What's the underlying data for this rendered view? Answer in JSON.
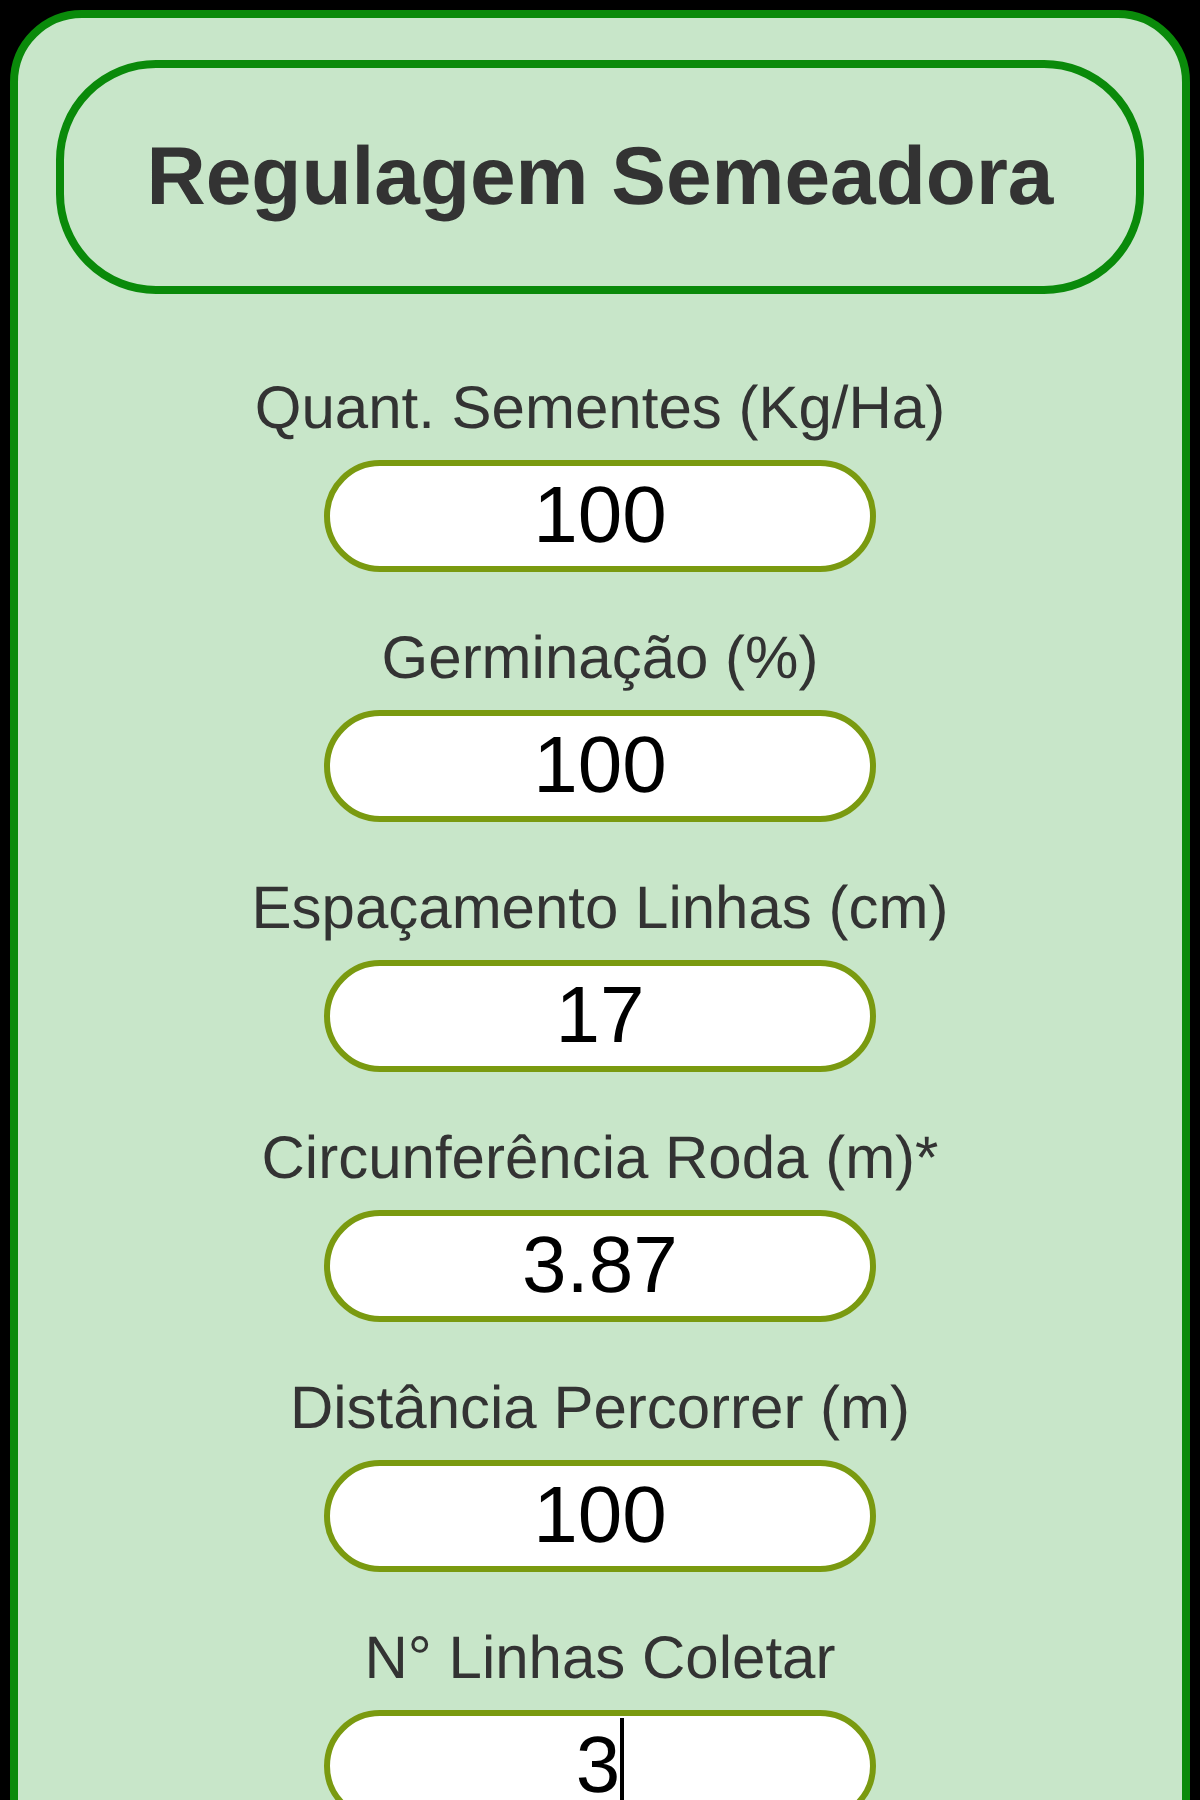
{
  "title": "Regulagem Semeadora",
  "fields": [
    {
      "label": "Quant. Sementes (Kg/Ha)",
      "value": "100",
      "focused": false
    },
    {
      "label": "Germinação (%)",
      "value": "100",
      "focused": false
    },
    {
      "label": "Espaçamento Linhas (cm)",
      "value": "17",
      "focused": false
    },
    {
      "label": "Circunferência Roda (m)*",
      "value": "3.87",
      "focused": false
    },
    {
      "label": "Distância Percorrer (m)",
      "value": "100",
      "focused": false
    },
    {
      "label": "N° Linhas Coletar",
      "value": "3",
      "focused": true
    }
  ]
}
